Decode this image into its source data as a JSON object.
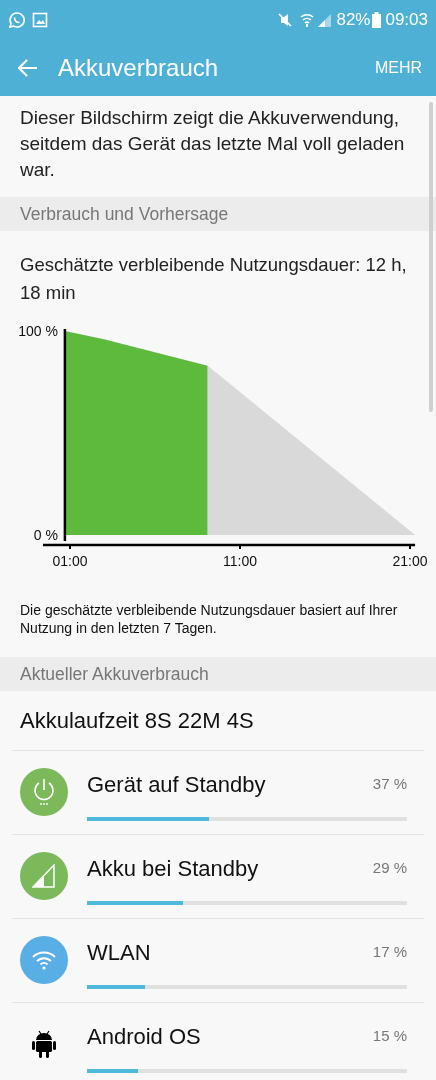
{
  "status_bar": {
    "battery": "82%",
    "time": "09:03"
  },
  "app_bar": {
    "title": "Akkuverbrauch",
    "action": "MEHR"
  },
  "intro": "Dieser Bildschirm zeigt die Akkuverwendung, seitdem das Gerät das letzte Mal voll geladen war.",
  "sections": [
    {
      "header": "Verbrauch und Vorhersage",
      "estimate": "Geschätzte verbleibende Nutzungsdauer: 12 h, 18 min",
      "chart_data": {
        "type": "area",
        "x": [
          0.7,
          3,
          9.1,
          21.3
        ],
        "series": [
          {
            "color": "#5dba3c",
            "values": [
              100,
              96,
              83,
              null
            ]
          },
          {
            "color": "#d9d9d9",
            "values": [
              null,
              null,
              83,
              0
            ]
          }
        ],
        "xlim": [
          0.7,
          21.3
        ],
        "ylim": [
          0,
          100
        ],
        "xticks": [
          {
            "value": 1,
            "label": "01:00"
          },
          {
            "value": 11,
            "label": "11:00"
          },
          {
            "value": 21,
            "label": "21:00"
          }
        ],
        "yticks": [
          {
            "value": 0,
            "label": "0 %"
          },
          {
            "value": 100,
            "label": "100 %"
          }
        ]
      },
      "note": "Die geschätzte verbleibende Nutzungsdauer basiert auf Ihrer Nutzung in den letzten 7 Tagen."
    },
    {
      "header": "Aktueller Akkuverbrauch",
      "runtime": "Akkulaufzeit 8S 22M 4S"
    }
  ],
  "items": [
    {
      "kind": "power",
      "color": "#7cb95a",
      "name": "Gerät auf Standby",
      "percent": "37 %",
      "level": 0.38
    },
    {
      "kind": "signal",
      "color": "#7cb95a",
      "name": "Akku bei Standby",
      "percent": "29 %",
      "level": 0.3
    },
    {
      "kind": "wifi",
      "color": "#5aaee6",
      "name": "WLAN",
      "percent": "17 %",
      "level": 0.18
    },
    {
      "kind": "android",
      "name": "Android OS",
      "percent": "15 %",
      "level": 0.16
    }
  ]
}
